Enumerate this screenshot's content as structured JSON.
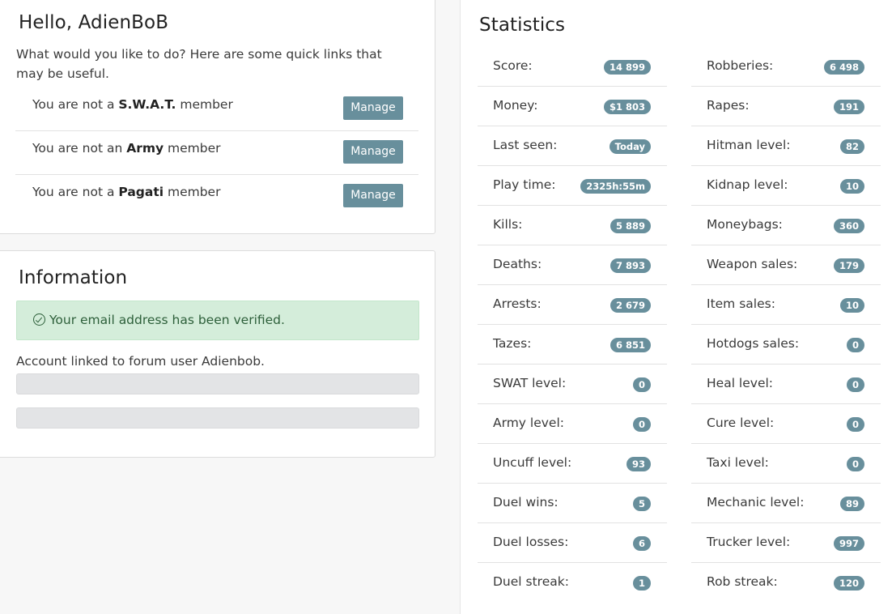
{
  "welcome": {
    "title": "Hello, AdienBoB",
    "intro": "What would you like to do? Here are some quick links that may be useful.",
    "memberships": [
      {
        "prefix": "You are not a ",
        "group": "S.W.A.T.",
        "suffix": " member",
        "button": "Manage"
      },
      {
        "prefix": "You are not an ",
        "group": "Army",
        "suffix": " member",
        "button": "Manage"
      },
      {
        "prefix": "You are not a ",
        "group": "Pagati",
        "suffix": " member",
        "button": "Manage"
      }
    ]
  },
  "information": {
    "title": "Information",
    "alert": "Your email address has been verified.",
    "alert_icon": "check-circle-icon",
    "forum_link": "Account linked to forum user Adienbob."
  },
  "statistics": {
    "title": "Statistics",
    "left": [
      {
        "label": "Score:",
        "value": "14 899"
      },
      {
        "label": "Money:",
        "value": "$1 803"
      },
      {
        "label": "Last seen:",
        "value": "Today"
      },
      {
        "label": "Play time:",
        "value": "2325h:55m"
      },
      {
        "label": "Kills:",
        "value": "5 889"
      },
      {
        "label": "Deaths:",
        "value": "7 893"
      },
      {
        "label": "Arrests:",
        "value": "2 679"
      },
      {
        "label": "Tazes:",
        "value": "6 851"
      },
      {
        "label": "SWAT level:",
        "value": "0"
      },
      {
        "label": "Army level:",
        "value": "0"
      },
      {
        "label": "Uncuff level:",
        "value": "93"
      },
      {
        "label": "Duel wins:",
        "value": "5"
      },
      {
        "label": "Duel losses:",
        "value": "6"
      },
      {
        "label": "Duel streak:",
        "value": "1"
      }
    ],
    "right": [
      {
        "label": "Robberies:",
        "value": "6 498"
      },
      {
        "label": "Rapes:",
        "value": "191"
      },
      {
        "label": "Hitman level:",
        "value": "82"
      },
      {
        "label": "Kidnap level:",
        "value": "10"
      },
      {
        "label": "Moneybags:",
        "value": "360"
      },
      {
        "label": "Weapon sales:",
        "value": "179"
      },
      {
        "label": "Item sales:",
        "value": "10"
      },
      {
        "label": "Hotdogs sales:",
        "value": "0"
      },
      {
        "label": "Heal level:",
        "value": "0"
      },
      {
        "label": "Cure level:",
        "value": "0"
      },
      {
        "label": "Taxi level:",
        "value": "0"
      },
      {
        "label": "Mechanic level:",
        "value": "89"
      },
      {
        "label": "Trucker level:",
        "value": "997"
      },
      {
        "label": "Rob streak:",
        "value": "120"
      }
    ]
  },
  "colors": {
    "accent": "#688f9c",
    "success_bg": "#d4edda",
    "success_text": "#2d5f3a"
  }
}
